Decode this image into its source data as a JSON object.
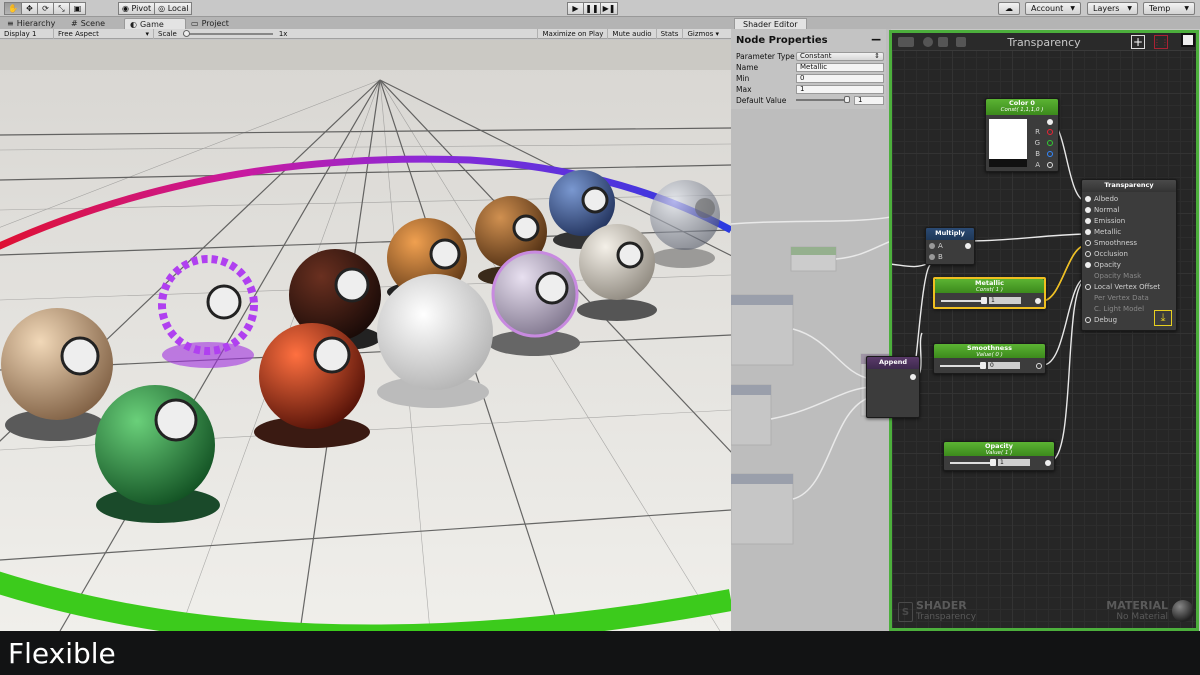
{
  "toolbar": {
    "pivot_label": "Pivot",
    "local_label": "Local",
    "account_label": "Account",
    "layers_label": "Layers",
    "layout_label": "Temp"
  },
  "tabs": [
    {
      "label": "Hierarchy"
    },
    {
      "label": "Scene"
    },
    {
      "label": "Game"
    },
    {
      "label": "Project"
    }
  ],
  "game_toolbar": {
    "display": "Display 1",
    "aspect": "Free Aspect",
    "scale_label": "Scale",
    "scale_value": "1x",
    "maximize": "Maximize on Play",
    "mute": "Mute audio",
    "stats": "Stats",
    "gizmos": "Gizmos"
  },
  "shader_editor": {
    "tab_label": "Shader Editor",
    "node_properties": {
      "title": "Node Properties",
      "rows": [
        {
          "label": "Parameter Type",
          "value": "Constant"
        },
        {
          "label": "Name",
          "value": "Metallic"
        },
        {
          "label": "Min",
          "value": "0"
        },
        {
          "label": "Max",
          "value": "1"
        },
        {
          "label": "Default Value",
          "value": "1"
        }
      ]
    },
    "canvas_title": "Transparency",
    "nodes": {
      "color": {
        "title": "Color 0",
        "sub": "Const( 1,1,1,0 )",
        "ports": [
          "R",
          "G",
          "B",
          "A"
        ]
      },
      "master": {
        "title": "Transparency",
        "ports": [
          "Albedo",
          "Normal",
          "Emission",
          "Metallic",
          "Smoothness",
          "Occlusion",
          "Opacity",
          "Opacity Mask",
          "Local Vertex Offset",
          "Per Vertex Data",
          "C. Light Model",
          "Debug"
        ]
      },
      "multiply": {
        "title": "Multiply",
        "ports": [
          "A",
          "B"
        ]
      },
      "metallic": {
        "title": "Metallic",
        "sub": "Const( 1 )",
        "value": "1"
      },
      "smoothness": {
        "title": "Smoothness",
        "sub": "Value( 0 )",
        "value": "0"
      },
      "append": {
        "title": "Append"
      },
      "opacity": {
        "title": "Opacity",
        "sub": "Value( 1 )",
        "value": "1"
      }
    },
    "brand": {
      "shader_title": "SHADER",
      "shader_name": "Transparency",
      "material_title": "MATERIAL",
      "material_name": "No Material"
    }
  },
  "caption": "Flexible"
}
